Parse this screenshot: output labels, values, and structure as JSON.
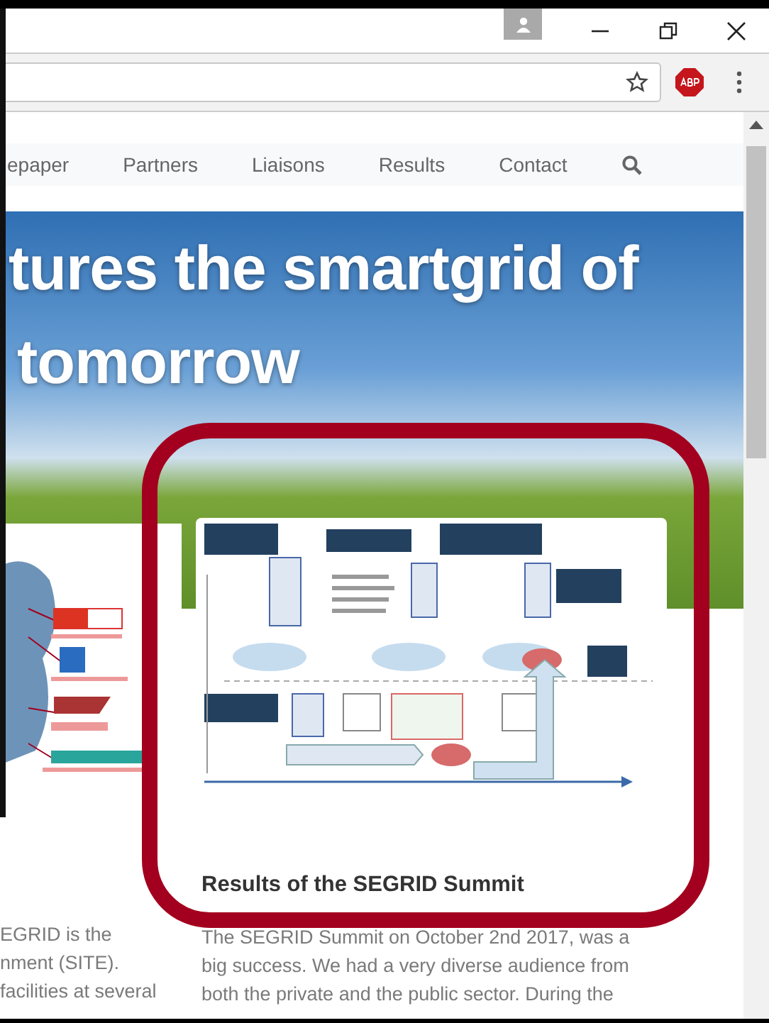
{
  "nav": [
    {
      "label": "epaper"
    },
    {
      "label": "Partners"
    },
    {
      "label": "Liaisons"
    },
    {
      "label": "Results"
    },
    {
      "label": "Contact"
    }
  ],
  "hero": {
    "title_lines": [
      "tures the smartgrid of",
      "tomorrow"
    ]
  },
  "left_column": {
    "lines": [
      "EGRID is the",
      "nment (SITE).",
      "facilities at several"
    ]
  },
  "right_column": {
    "heading": "Results of the SEGRID Summit",
    "lines": [
      "The SEGRID Summit on October 2nd 2017, was a",
      "big success. We had a very diverse audience from",
      "both the private and the public sector. During the"
    ]
  }
}
